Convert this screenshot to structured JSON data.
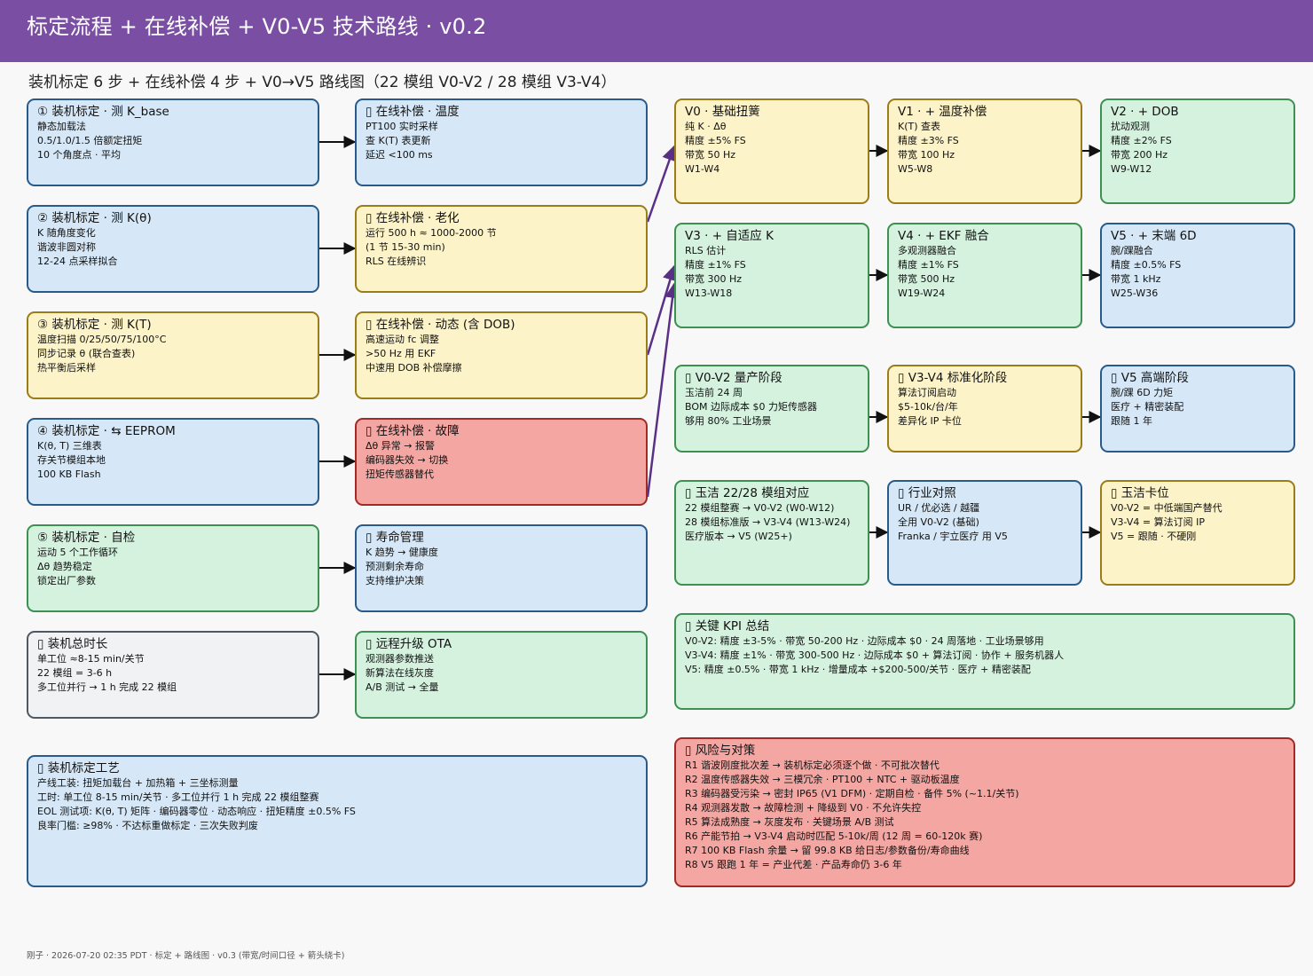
{
  "header": {
    "title": "标定流程 + 在线补偿 + V0-V5 技术路线 · v0.2"
  },
  "subtitle": "装机标定 6 步 + 在线补偿 4 步 + V0→V5 路线图（22 模组 V0-V2 / 28 模组 V3-V4）",
  "colors": {
    "title_bar": "#7a4fa3",
    "blue": "#d6e8f7",
    "yellow": "#fdf3c8",
    "green": "#d5f2df",
    "red": "#f4a7a2",
    "gray": "#f1f2f4",
    "arrow_dark": "#111111",
    "arrow_purple": "#5a2f86"
  },
  "calibration": [
    {
      "title": "① 装机标定 · 测 K_base",
      "lines": [
        "静态加载法",
        "0.5/1.0/1.5 倍额定扭矩",
        "10 个角度点 · 平均"
      ]
    },
    {
      "title": "② 装机标定 · 测 K(θ)",
      "lines": [
        "K 随角度变化",
        "谐波非圆对称",
        "12-24 点采样拟合"
      ]
    },
    {
      "title": "③ 装机标定 · 测 K(T)",
      "lines": [
        "温度扫描 0/25/50/75/100°C",
        "同步记录 θ (联合查表)",
        "热平衡后采样"
      ]
    },
    {
      "title": "④ 装机标定 · ⇆ EEPROM",
      "lines": [
        "K(θ, T) 三维表",
        "存关节模组本地",
        "100 KB Flash"
      ]
    },
    {
      "title": "⑤ 装机标定 · 自检",
      "lines": [
        "运动 5 个工作循环",
        "Δθ 趋势稳定",
        "锁定出厂参数"
      ]
    },
    {
      "title": "▯ 装机总时长",
      "lines": [
        "单工位 ≈8-15 min/关节",
        "22 模组 = 3-6 h",
        "多工位并行 → 1 h 完成 22 模组"
      ]
    }
  ],
  "online": [
    {
      "title": "▯ 在线补偿 · 温度",
      "lines": [
        "PT100 实时采样",
        "查 K(T) 表更新",
        "延迟 <100 ms"
      ]
    },
    {
      "title": "▯ 在线补偿 · 老化",
      "lines": [
        "运行 500 h ≈ 1000-2000 节",
        "(1 节 15-30 min)",
        "RLS 在线辨识"
      ]
    },
    {
      "title": "▯ 在线补偿 · 动态 (含 DOB)",
      "lines": [
        "高速运动 fc 调整",
        ">50 Hz 用 EKF",
        "中速用 DOB 补偿摩擦"
      ]
    },
    {
      "title": "▯ 在线补偿 · 故障",
      "lines": [
        "Δθ 异常 → 报警",
        "编码器失效 → 切换",
        "扭矩传感器替代"
      ]
    },
    {
      "title": "▯ 寿命管理",
      "lines": [
        "K 趋势 → 健康度",
        "预测剩余寿命",
        "支持维护决策"
      ]
    },
    {
      "title": "▯ 远程升级 OTA",
      "lines": [
        "观测器参数推送",
        "新算法在线灰度",
        "A/B 测试 → 全量"
      ]
    }
  ],
  "process": {
    "title": "▯ 装机标定工艺",
    "lines": [
      "产线工装: 扭矩加载台 + 加热箱 + 三坐标测量",
      "工时: 单工位 8-15 min/关节 · 多工位并行 1 h 完成 22 模组整赛",
      "EOL 测试项: K(θ, T) 矩阵 · 编码器零位 · 动态响应 · 扭矩精度 ±0.5% FS",
      "良率门槛: ≥98% · 不达标重做标定 · 三次失败判废"
    ]
  },
  "roadmap": [
    {
      "title": "V0 · 基础扭簧",
      "lines": [
        "纯 K · Δθ",
        "精度 ±5% FS",
        "带宽 50 Hz",
        "W1-W4"
      ]
    },
    {
      "title": "V1 · + 温度补偿",
      "lines": [
        "K(T) 查表",
        "精度 ±3% FS",
        "带宽 100 Hz",
        "W5-W8"
      ]
    },
    {
      "title": "V2 · + DOB",
      "lines": [
        "扰动观测",
        "精度 ±2% FS",
        "带宽 200 Hz",
        "W9-W12"
      ]
    },
    {
      "title": "V3 · + 自适应 K",
      "lines": [
        "RLS 估计",
        "精度 ±1% FS",
        "带宽 300 Hz",
        "W13-W18"
      ]
    },
    {
      "title": "V4 · + EKF 融合",
      "lines": [
        "多观测器融合",
        "精度 ±1% FS",
        "带宽 500 Hz",
        "W19-W24"
      ]
    },
    {
      "title": "V5 · + 末端 6D",
      "lines": [
        "腕/踝融合",
        "精度 ±0.5% FS",
        "带宽 1 kHz",
        "W25-W36"
      ]
    }
  ],
  "phases": [
    {
      "title": "▯ V0-V2 量产阶段",
      "lines": [
        "玉洁前 24 周",
        "BOM 边际成本 $0 力矩传感器",
        "够用 80% 工业场景"
      ]
    },
    {
      "title": "▯ V3-V4 标准化阶段",
      "lines": [
        "算法订阅启动",
        "$5-10k/台/年",
        "差异化 IP 卡位"
      ]
    },
    {
      "title": "▯ V5 高端阶段",
      "lines": [
        "腕/踝 6D 力矩",
        "医疗 + 精密装配",
        "跟随 1 年"
      ]
    }
  ],
  "mapping": [
    {
      "title": "▯ 玉洁 22/28 模组对应",
      "lines": [
        "22 模组整赛 → V0-V2 (W0-W12)",
        "28 模组标准版 → V3-V4 (W13-W24)",
        "医疗版本 → V5 (W25+)"
      ]
    },
    {
      "title": "▯ 行业对照",
      "lines": [
        "UR / 优必选 / 越疆",
        "全用 V0-V2 (基础)",
        "Franka / 宇立医疗 用 V5"
      ]
    },
    {
      "title": "▯ 玉洁卡位",
      "lines": [
        "V0-V2 = 中低端国产替代",
        "V3-V4 = 算法订阅 IP",
        "V5 = 跟随 · 不硬刚"
      ]
    }
  ],
  "kpi": {
    "title": "▯ 关键 KPI 总结",
    "lines": [
      "V0-V2: 精度 ±3-5% · 带宽 50-200 Hz · 边际成本 $0 · 24 周落地 · 工业场景够用",
      "V3-V4: 精度 ±1% · 带宽 300-500 Hz · 边际成本 $0 + 算法订阅 · 协作 + 服务机器人",
      "V5: 精度 ±0.5% · 带宽 1 kHz · 增量成本 +$200-500/关节 · 医疗 + 精密装配"
    ]
  },
  "risk": {
    "title": "▯ 风险与对策",
    "lines": [
      "R1 谐波刚度批次差 → 装机标定必须逐个做 · 不可批次替代",
      "R2 温度传感器失效 → 三模冗余 · PT100 + NTC + 驱动板温度",
      "R3 编码器受污染 → 密封 IP65 (V1 DFM) · 定期自检 · 备件 5% (~1.1/关节)",
      "R4 观测器发散 → 故障检测 + 降级到 V0 · 不允许失控",
      "R5 算法成熟度 → 灰度发布 · 关键场景 A/B 测试",
      "R6 产能节拍 → V3-V4 启动时匹配 5-10k/周 (12 周 = 60-120k 赛)",
      "R7 100 KB Flash 余量 → 留 99.8 KB 给日志/参数备份/寿命曲线",
      "R8 V5 跟跑 1 年 = 产业代差 · 产品寿命仍 3-6 年"
    ]
  },
  "footer": "刚子 · 2026-07-20 02:35 PDT · 标定 + 路线图 · v0.3 (带宽/时间口径 + 箭头绕卡)"
}
